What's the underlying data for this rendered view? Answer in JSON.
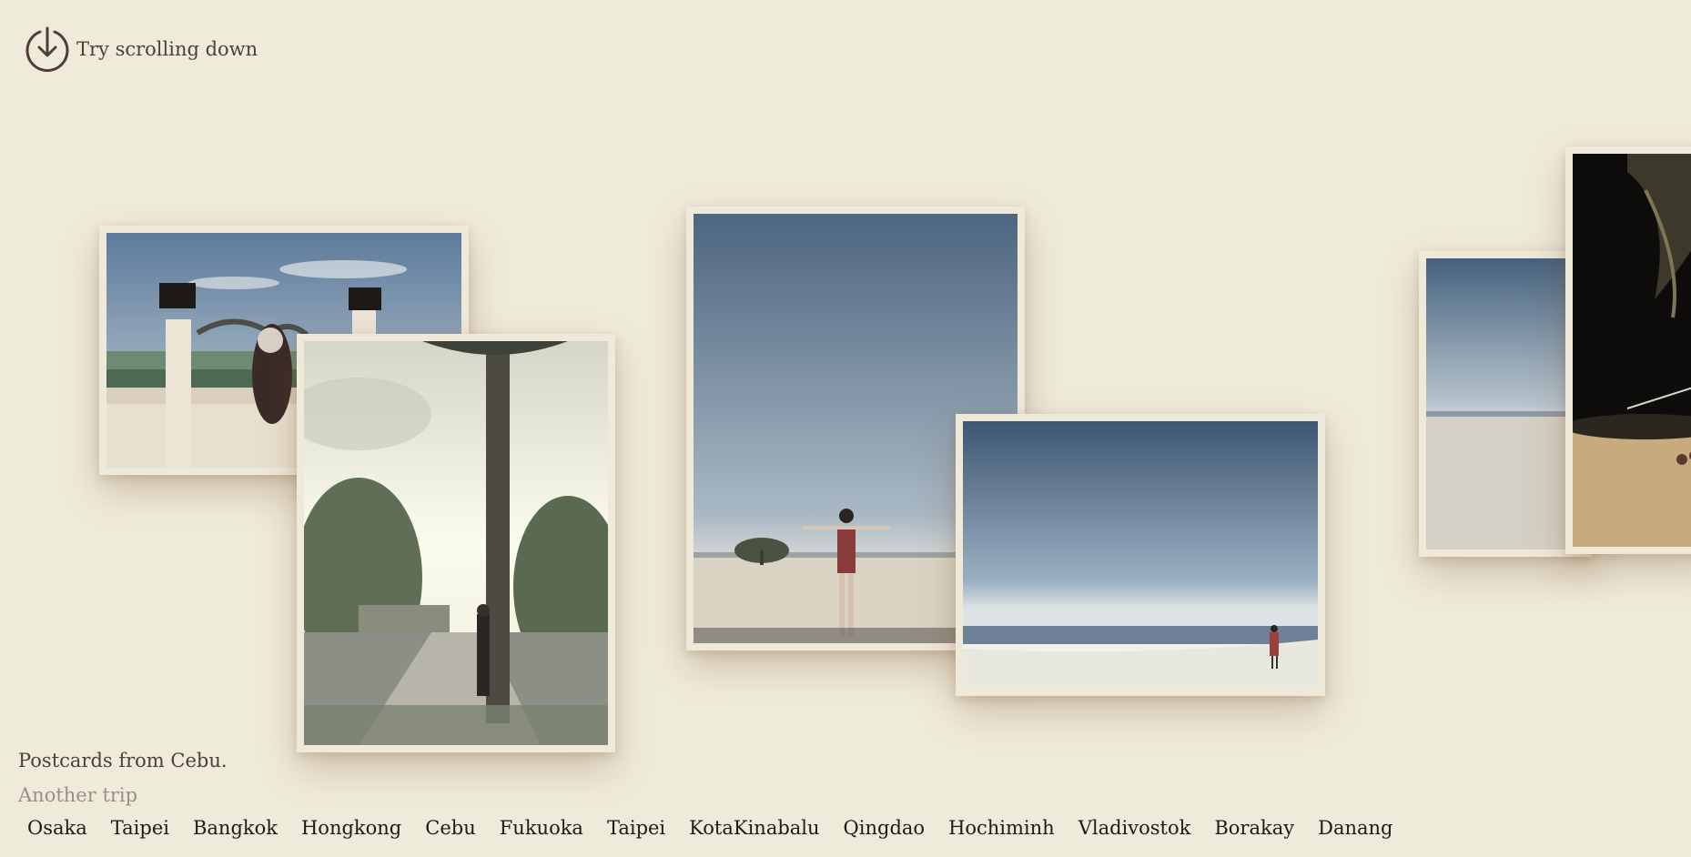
{
  "hint": {
    "label": "Try scrolling down",
    "icon": "arrow-down-circle-icon"
  },
  "caption": "Postcards from Cebu.",
  "another_trip": "Another trip",
  "trips": [
    "Osaka",
    "Taipei",
    "Bangkok",
    "Hongkong",
    "Cebu",
    "Fukuoka",
    "Taipei",
    "KotaKinabalu",
    "Qingdao",
    "Hochiminh",
    "Vladivostok",
    "Borakay",
    "Danang"
  ],
  "photos": [
    {
      "name": "photo-temple-lanterns"
    },
    {
      "name": "photo-palm-tree-walkway"
    },
    {
      "name": "photo-sandbar-arms-open"
    },
    {
      "name": "photo-beach-horizon"
    },
    {
      "name": "photo-beach-partial"
    },
    {
      "name": "photo-night-beach-partial"
    }
  ],
  "colors": {
    "background": "#efebdb",
    "text": "#4f3d36",
    "muted": "#9b8e85",
    "card_border": "#efe9da"
  }
}
